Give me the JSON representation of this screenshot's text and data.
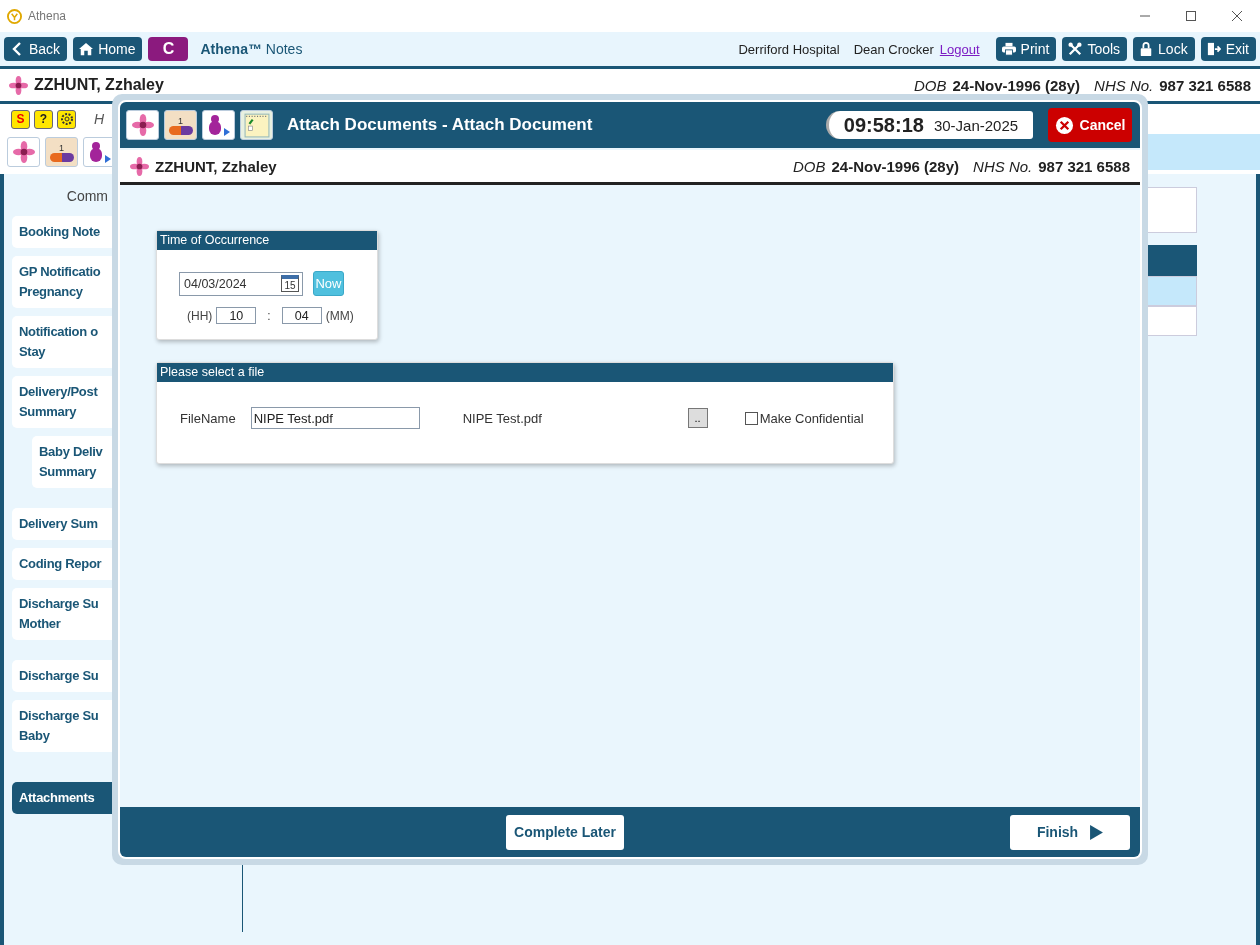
{
  "window": {
    "title": "Athena"
  },
  "toolbar": {
    "nav_buttons": [
      {
        "kind": "back",
        "label": "Back"
      },
      {
        "kind": "home",
        "label": "Home"
      }
    ],
    "app_badge": "C",
    "app_name": "**Athena™** Notes",
    "hospital": "Derriford Hospital",
    "user": "Dean Crocker",
    "logout": "Logout",
    "action_buttons": [
      {
        "kind": "print",
        "label": "Print"
      },
      {
        "kind": "tools",
        "label": "Tools"
      },
      {
        "kind": "lock",
        "label": "Lock"
      },
      {
        "kind": "exit",
        "label": "Exit"
      }
    ]
  },
  "patient": {
    "name": "ZZHUNT, Zzhaley",
    "dob_label": "DOB",
    "dob": "24-Nov-1996 (28y)",
    "nhs_label": "NHS No.",
    "nhs": "987 321 6588"
  },
  "quick_icons": [
    {
      "kind": "s-hand",
      "glyph": "S"
    },
    {
      "kind": "help",
      "glyph": "?"
    },
    {
      "kind": "gear"
    }
  ],
  "quick_text": "H",
  "patient_icons": [
    {
      "kind": "flower"
    },
    {
      "kind": "pill",
      "glyph": "1"
    },
    {
      "kind": "person"
    }
  ],
  "sidebar": {
    "heading": "Comm",
    "groups": [
      [
        {
          "lines": [
            "Booking Note"
          ],
          "selected": false
        },
        {
          "lines": [
            "GP Notificatio",
            "Pregnancy"
          ],
          "selected": false
        },
        {
          "lines": [
            "Notification o",
            "Stay"
          ],
          "selected": false
        },
        {
          "lines": [
            "Delivery/Post",
            "Summary"
          ],
          "selected": false,
          "children": [
            {
              "lines": [
                "Baby Deliv",
                "Summary"
              ],
              "selected": false
            }
          ]
        }
      ],
      [
        {
          "lines": [
            "Delivery Sum"
          ],
          "selected": false
        },
        {
          "lines": [
            "Coding Repor"
          ],
          "selected": false
        },
        {
          "lines": [
            "Discharge Su",
            "Mother"
          ],
          "selected": false
        }
      ],
      [
        {
          "lines": [
            "Discharge Su"
          ],
          "selected": false
        },
        {
          "lines": [
            "Discharge Su",
            "Baby"
          ],
          "selected": false
        }
      ],
      [
        {
          "lines": [
            "Attachments"
          ],
          "selected": true
        }
      ]
    ]
  },
  "modal": {
    "icons": [
      {
        "kind": "flower"
      },
      {
        "kind": "pill",
        "glyph": "1"
      },
      {
        "kind": "person"
      },
      {
        "kind": "notepad"
      }
    ],
    "title": "Attach Documents - Attach Document",
    "time": "09:58:18",
    "date": "30-Jan-2025",
    "cancel": "Cancel",
    "patient": {
      "name": "ZZHUNT, Zzhaley",
      "dob_label": "DOB",
      "dob": "24-Nov-1996 (28y)",
      "nhs_label": "NHS No.",
      "nhs": "987 321 6588"
    },
    "occurrence": {
      "title": "Time of Occurrence",
      "date": "04/03/2024",
      "calendar_day": "15",
      "now": "Now",
      "hh_label": "(HH)",
      "hh": "10",
      "separator": ":",
      "mm": "04",
      "mm_label": "(MM)"
    },
    "file": {
      "title": "Please select a file",
      "label": "FileName",
      "value": "NIPE Test.pdf",
      "display": "NIPE Test.pdf",
      "browse": "..",
      "confidential": {
        "label": "Make Confidential",
        "checked": false
      }
    },
    "footer": {
      "complete_later": "Complete Later",
      "finish": "Finish"
    }
  }
}
